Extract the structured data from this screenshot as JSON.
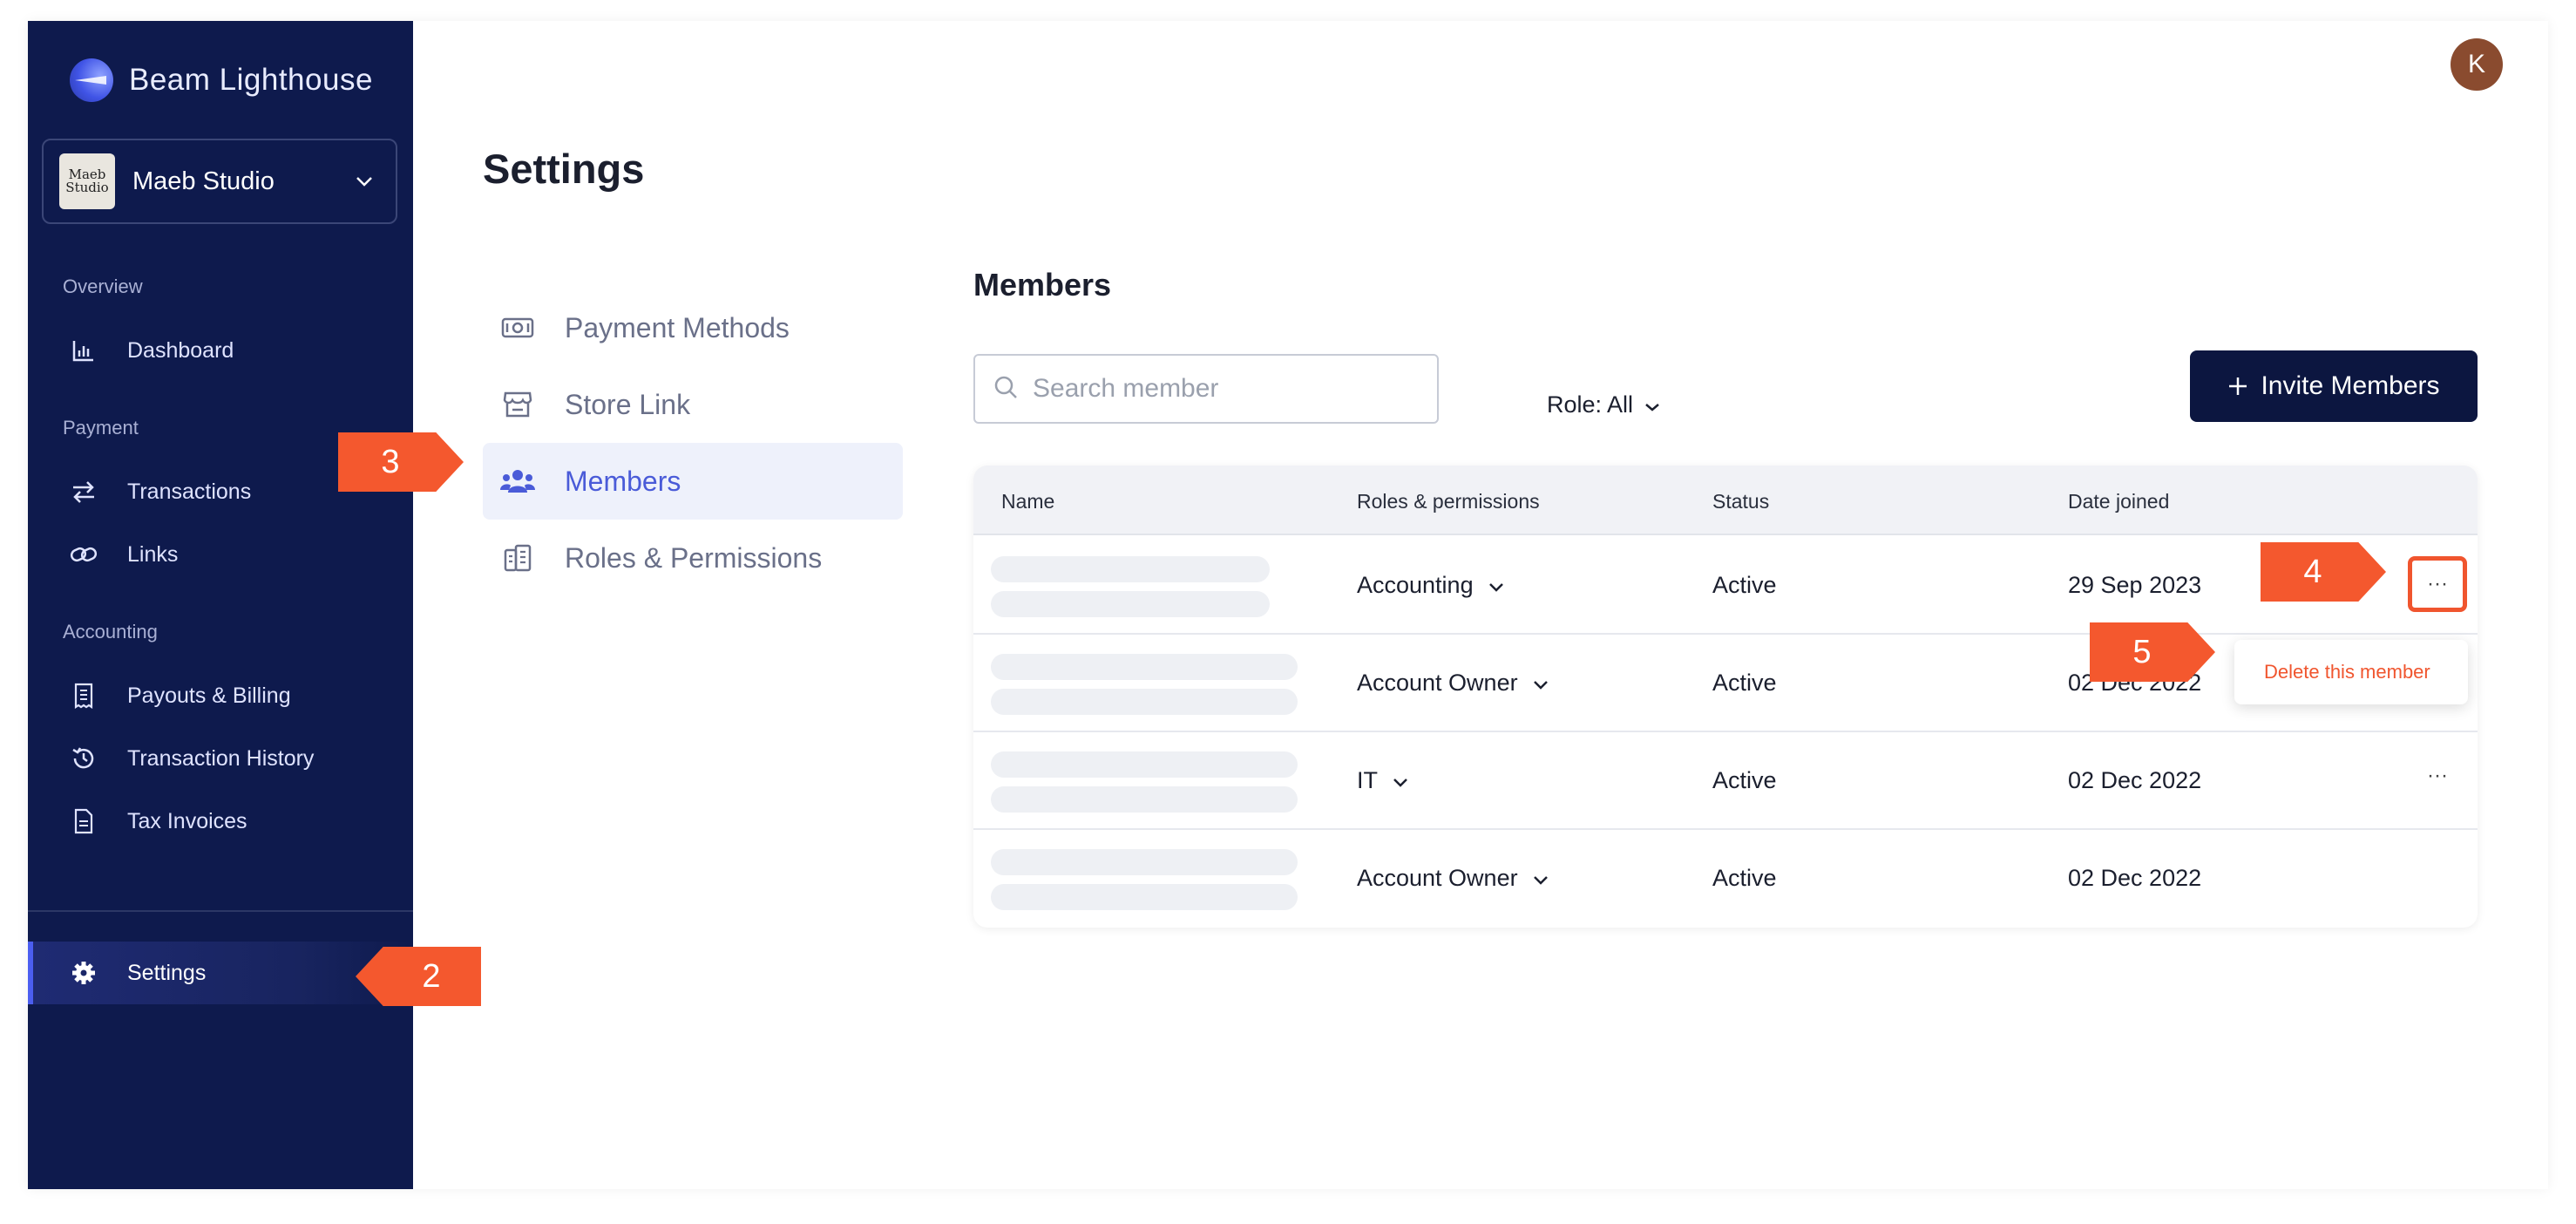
{
  "brand": {
    "name": "Beam Lighthouse"
  },
  "org": {
    "name": "Maeb Studio",
    "avatar_text": "Maeb\nStudio"
  },
  "sidebar": {
    "sections": [
      {
        "label": "Overview"
      },
      {
        "label": "Payment"
      },
      {
        "label": "Accounting"
      }
    ],
    "items": {
      "dashboard": "Dashboard",
      "transactions": "Transactions",
      "links": "Links",
      "payouts": "Payouts & Billing",
      "history": "Transaction History",
      "tax": "Tax Invoices",
      "settings": "Settings"
    }
  },
  "user": {
    "initial": "K"
  },
  "page": {
    "title": "Settings"
  },
  "settings_nav": {
    "payment_methods": "Payment Methods",
    "store_link": "Store Link",
    "members": "Members",
    "roles": "Roles & Permissions"
  },
  "members": {
    "title": "Members",
    "search_placeholder": "Search member",
    "role_filter": "Role: All",
    "invite_label": "Invite Members",
    "columns": [
      "Name",
      "Roles & permissions",
      "Status",
      "Date joined"
    ],
    "rows": [
      {
        "role": "Accounting",
        "status": "Active",
        "date": "29 Sep 2023"
      },
      {
        "role": "Account Owner",
        "status": "Active",
        "date": "02 Dec 2022"
      },
      {
        "role": "IT",
        "status": "Active",
        "date": "02 Dec 2022"
      },
      {
        "role": "Account Owner",
        "status": "Active",
        "date": "02 Dec 2022"
      }
    ],
    "more_label": "···",
    "dropdown_item": "Delete this member"
  },
  "callouts": {
    "c2": "2",
    "c3": "3",
    "c4": "4",
    "c5": "5"
  },
  "colors": {
    "sidebar": "#0e1a4d",
    "accent": "#4a5bd8",
    "callout": "#f4582e",
    "primary_button": "#0c1640",
    "danger": "#f0552e"
  }
}
